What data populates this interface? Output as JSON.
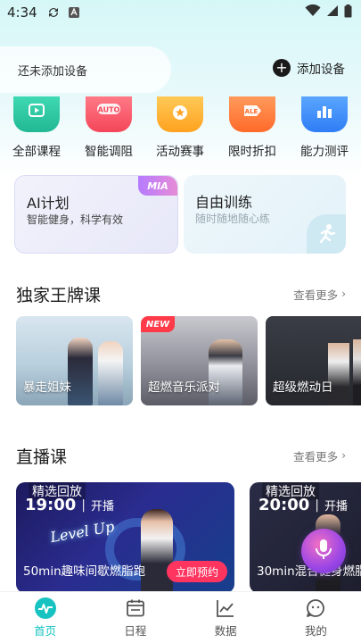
{
  "status_bar": {
    "time": "4:34"
  },
  "device": {
    "empty_text": "还未添加设备",
    "add_label": "添加设备"
  },
  "categories": [
    {
      "label": "全部课程",
      "icon": "play-icon",
      "color": "#2ec6a2"
    },
    {
      "label": "智能调阻",
      "icon": "auto-icon",
      "color": "#ff5a6a"
    },
    {
      "label": "活动赛事",
      "icon": "star-medal-icon",
      "color": "#ffb22e"
    },
    {
      "label": "限时折扣",
      "icon": "sale-tag-icon",
      "color": "#ff7b3a"
    },
    {
      "label": "能力测评",
      "icon": "chart-icon",
      "color": "#3a8cff"
    }
  ],
  "ai_card": {
    "title": "AI计划",
    "subtitle": "智能健身，科学有效",
    "badge": "MIA"
  },
  "free_card": {
    "title": "自由训练",
    "subtitle": "随时随地随心练"
  },
  "exclusive": {
    "title": "独家王牌课",
    "more": "查看更多",
    "courses": [
      {
        "label": "暴走姐妹",
        "badge": ""
      },
      {
        "label": "超燃音乐派对",
        "badge": "NEW"
      },
      {
        "label": "超级燃动日",
        "badge": ""
      }
    ]
  },
  "live": {
    "title": "直播课",
    "more": "查看更多",
    "courses": [
      {
        "tag": "精选回放",
        "time": "19:00",
        "state": "开播",
        "title": "50min趣味间歇燃脂跑",
        "button": "立即预约",
        "art_text": "Level Up"
      },
      {
        "tag": "精选回放",
        "time": "20:00",
        "state": "开播",
        "title": "30min混合健身燃脂"
      }
    ]
  },
  "nav": [
    {
      "label": "首页",
      "icon": "pulse-icon",
      "active": true
    },
    {
      "label": "日程",
      "icon": "calendar-icon",
      "active": false
    },
    {
      "label": "数据",
      "icon": "line-chart-icon",
      "active": false
    },
    {
      "label": "我的",
      "icon": "chat-face-icon",
      "active": false
    }
  ]
}
